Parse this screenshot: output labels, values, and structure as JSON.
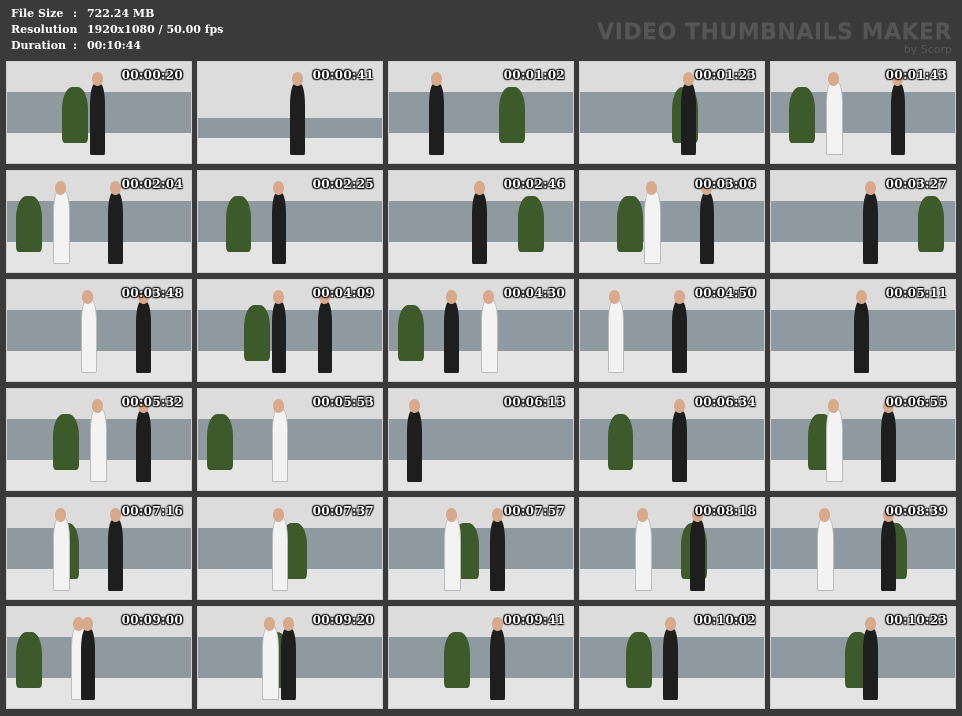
{
  "info": {
    "file_size_label": "File Size",
    "file_size_value": "722.24 MB",
    "resolution_label": "Resolution",
    "resolution_value": "1920x1080 / 50.00 fps",
    "duration_label": "Duration",
    "duration_value": "00:10:44",
    "separator": ":"
  },
  "watermark": {
    "title": "VIDEO THUMBNAILS MAKER",
    "subtitle": "by Scorp"
  },
  "thumbnails": [
    {
      "time": "00:00:20"
    },
    {
      "time": "00:00:41"
    },
    {
      "time": "00:01:02"
    },
    {
      "time": "00:01:23"
    },
    {
      "time": "00:01:43"
    },
    {
      "time": "00:02:04"
    },
    {
      "time": "00:02:25"
    },
    {
      "time": "00:02:46"
    },
    {
      "time": "00:03:06"
    },
    {
      "time": "00:03:27"
    },
    {
      "time": "00:03:48"
    },
    {
      "time": "00:04:09"
    },
    {
      "time": "00:04:30"
    },
    {
      "time": "00:04:50"
    },
    {
      "time": "00:05:11"
    },
    {
      "time": "00:05:32"
    },
    {
      "time": "00:05:53"
    },
    {
      "time": "00:06:13"
    },
    {
      "time": "00:06:34"
    },
    {
      "time": "00:06:55"
    },
    {
      "time": "00:07:16"
    },
    {
      "time": "00:07:37"
    },
    {
      "time": "00:07:57"
    },
    {
      "time": "00:08:18"
    },
    {
      "time": "00:08:39"
    },
    {
      "time": "00:09:00"
    },
    {
      "time": "00:09:20"
    },
    {
      "time": "00:09:41"
    },
    {
      "time": "00:10:02"
    },
    {
      "time": "00:10:23"
    }
  ],
  "colors": {
    "background": "#3a3a3a",
    "text": "#ffffff",
    "watermark": "#555555",
    "wall": "#8e9aa0",
    "floor": "#e4e4e4",
    "foliage": "#3d5a2a"
  }
}
